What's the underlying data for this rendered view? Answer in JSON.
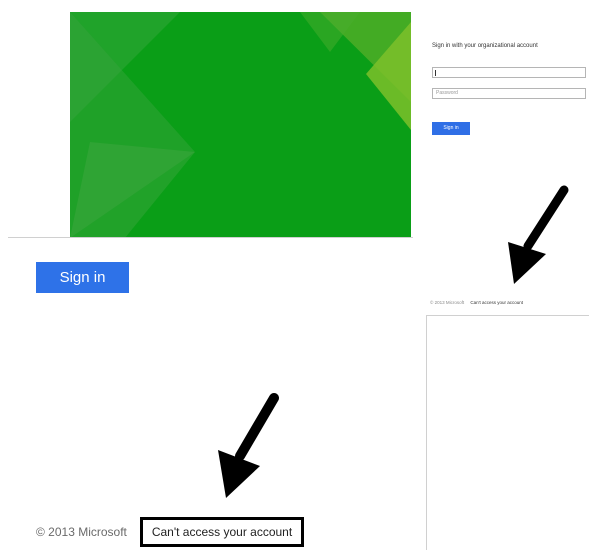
{
  "small_panel": {
    "heading": "Sign in with your organizational account",
    "username_placeholder": "",
    "password_placeholder": "Password",
    "sign_in_label": "Sign in",
    "copyright": "© 2013 Microsoft",
    "cant_access_link": "Can't access your account"
  },
  "large_view": {
    "sign_in_label": "Sign in",
    "copyright": "© 2013 Microsoft",
    "cant_access_link": "Can't access your account"
  },
  "colors": {
    "hero_green": "#0a9e17",
    "button_blue": "#2e72e8",
    "arrow": "#000000"
  },
  "icons": {
    "annotation_arrows": [
      "arrow-down-left-icon",
      "arrow-down-left-icon"
    ]
  }
}
